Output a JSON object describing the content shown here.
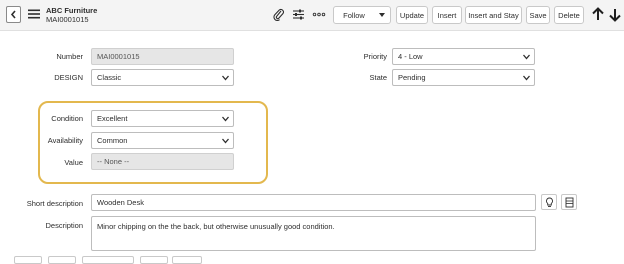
{
  "header": {
    "title": "ABC Furniture",
    "record_id": "MAI0001015",
    "follow_label": "Follow",
    "buttons": [
      "Update",
      "Insert",
      "Insert and Stay",
      "Save",
      "Delete"
    ]
  },
  "icons": {
    "back": "chevron-left-icon",
    "menu": "hamburger-menu-icon",
    "attach": "paperclip-icon",
    "settings": "sliders-icon",
    "more": "more-options-icon",
    "up": "arrow-up-icon",
    "down": "arrow-down-icon"
  },
  "form": {
    "number": {
      "label": "Number",
      "value": "MAI0001015"
    },
    "design": {
      "label": "DESIGN",
      "value": "Classic"
    },
    "priority": {
      "label": "Priority",
      "value": "4 - Low"
    },
    "state": {
      "label": "State",
      "value": "Pending"
    },
    "condition": {
      "label": "Condition",
      "value": "Excellent"
    },
    "availability": {
      "label": "Availability",
      "value": "Common"
    },
    "value": {
      "label": "Value",
      "value": "-- None --"
    },
    "short_description": {
      "label": "Short description",
      "value": "Wooden Desk"
    },
    "description": {
      "label": "Description",
      "value": "Minor chipping on the the back, but otherwise unusually good condition."
    }
  },
  "colors": {
    "highlight": "#e3b84e",
    "readonly_bg": "#e6e6e6",
    "header_bg": "#f4f4f4"
  }
}
